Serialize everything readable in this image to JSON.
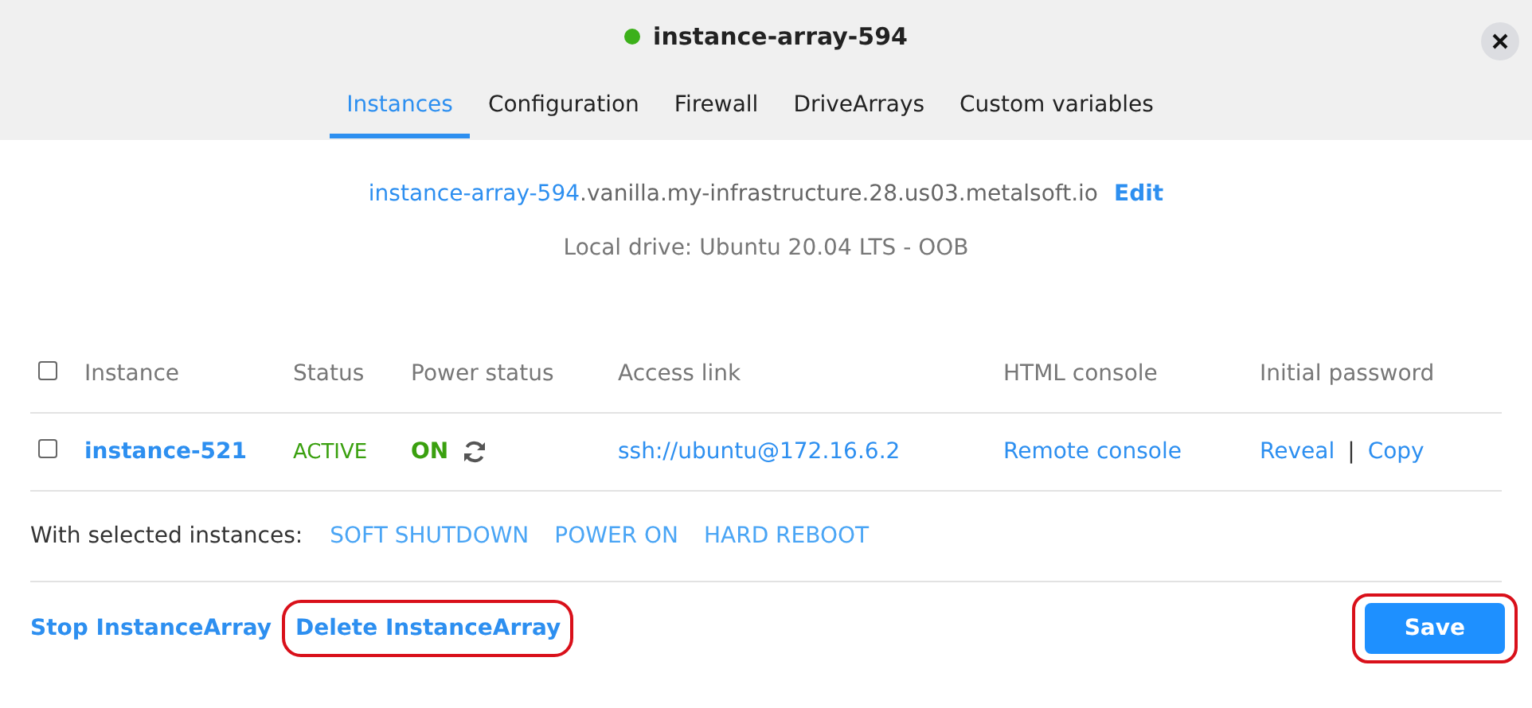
{
  "header": {
    "title": "instance-array-594"
  },
  "tabs": [
    {
      "label": "Instances",
      "selected": true
    },
    {
      "label": "Configuration",
      "selected": false
    },
    {
      "label": "Firewall",
      "selected": false
    },
    {
      "label": "DriveArrays",
      "selected": false
    },
    {
      "label": "Custom variables",
      "selected": false
    }
  ],
  "hostname": {
    "link": "instance-array-594",
    "rest": ".vanilla.my-infrastructure.28.us03.metalsoft.io",
    "action": "Edit"
  },
  "local_drive": "Local drive: Ubuntu 20.04 LTS - OOB",
  "table": {
    "select_all_checked": false,
    "columns": [
      "Instance",
      "Status",
      "Power status",
      "Access link",
      "HTML console",
      "Initial password"
    ],
    "rows": [
      {
        "checked": false,
        "instance": "instance-521",
        "status": "ACTIVE",
        "power": "ON",
        "access_link": "ssh://ubuntu@172.16.6.2",
        "console": "Remote console",
        "reveal": "Reveal",
        "separator": "|",
        "copy": "Copy"
      }
    ]
  },
  "bulk_actions": {
    "label": "With selected instances:",
    "actions": [
      "SOFT SHUTDOWN",
      "POWER ON",
      "HARD REBOOT"
    ]
  },
  "footer": {
    "links": [
      {
        "label": "Stop InstanceArray",
        "highlighted": false
      },
      {
        "label": "Delete InstanceArray",
        "highlighted": true
      }
    ],
    "save": {
      "label": "Save",
      "highlighted": true
    }
  }
}
